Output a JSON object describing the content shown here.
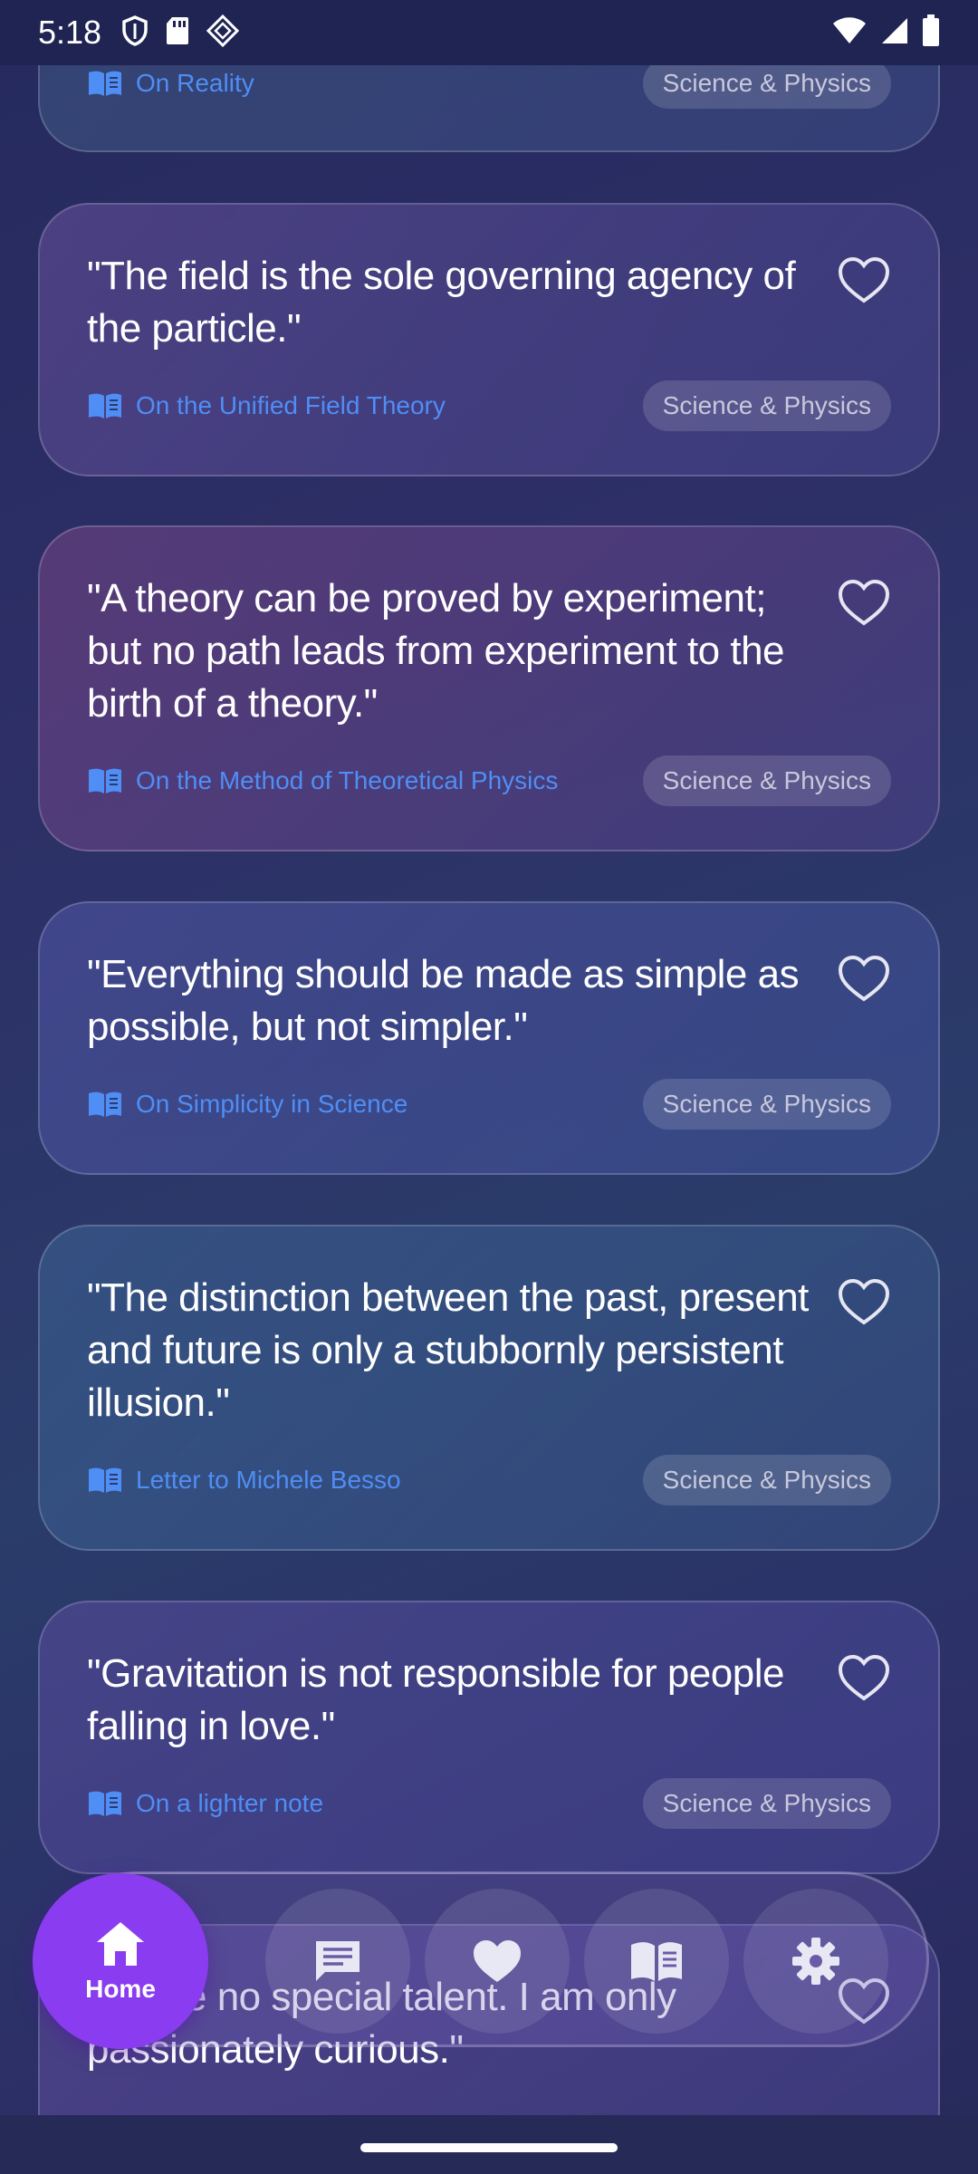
{
  "status_bar": {
    "time": "5:18"
  },
  "chip_label": "Science & Physics",
  "cards": [
    {
      "quote": "",
      "source": "On Reality"
    },
    {
      "quote": "\"The field is the sole governing agency of the particle.\"",
      "source": "On the Unified Field Theory"
    },
    {
      "quote": "\"A theory can be proved by experiment; but no path leads from experiment to the birth of a theory.\"",
      "source": "On the Method of Theoretical Physics"
    },
    {
      "quote": "\"Everything should be made as simple as possible, but not simpler.\"",
      "source": "On Simplicity in Science"
    },
    {
      "quote": "\"The distinction between the past, present and future is only a stubbornly persistent illusion.\"",
      "source": "Letter to Michele Besso"
    },
    {
      "quote": "\"Gravitation is not responsible for people falling in love.\"",
      "source": "On a lighter note"
    },
    {
      "quote": "\"I have no special talent. I am only passionately curious.\"",
      "source": ""
    }
  ],
  "nav": {
    "home_label": "Home",
    "items": [
      "home-icon",
      "chat-icon",
      "heart-icon",
      "book-icon",
      "settings-icon"
    ]
  },
  "colors": {
    "accent": "#8a3cf0",
    "source_link": "#4f8ef5"
  }
}
